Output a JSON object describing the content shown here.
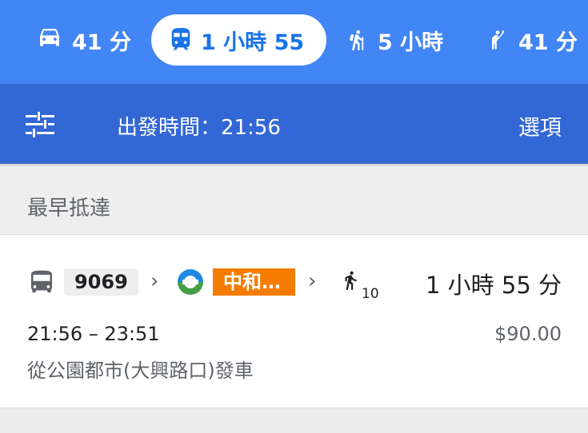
{
  "modes": [
    {
      "icon": "car-icon",
      "label": "41 分"
    },
    {
      "icon": "transit-icon",
      "label": "1 小時 55",
      "selected": true
    },
    {
      "icon": "hiking-icon",
      "label": "5 小時"
    },
    {
      "icon": "hail-icon",
      "label": "41 分"
    }
  ],
  "options_bar": {
    "departure": "出發時間：21:56",
    "options_label": "選項"
  },
  "section": {
    "title": "最早抵達"
  },
  "route": {
    "bus_number": "9069",
    "metro_label": "中和…",
    "walk_minutes": "10",
    "duration": "1 小時 55 分",
    "time_range": "21:56 – 23:51",
    "fare": "$90.00",
    "origin": "從公園都市(大興路口)發車"
  },
  "colors": {
    "mode_bar": "#4285f4",
    "options_bar": "#3367d6",
    "metro_orange": "#f57c00"
  }
}
